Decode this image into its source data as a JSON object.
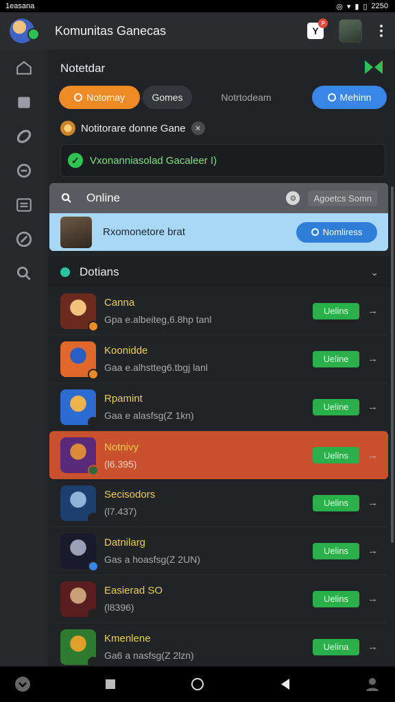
{
  "status_bar": {
    "left_text": "1easana",
    "time": "2250"
  },
  "app_bar": {
    "title": "Komunitas Ganecas",
    "notification_badge": "P"
  },
  "rail": {
    "icons": [
      "home-icon",
      "inbox-icon",
      "link-icon",
      "chat-icon",
      "list-icon",
      "close-icon",
      "search-icon"
    ]
  },
  "main": {
    "section_title": "Notetdar",
    "chips": [
      {
        "label": "Notomay",
        "active": true
      },
      {
        "label": "Gomes"
      },
      {
        "label": "Notrtodeam"
      },
      {
        "label": "Mehinn",
        "accent": "#3a86e6"
      }
    ],
    "notify_text": "Notitorare donne Gane",
    "banner_text": "Vxonanniasolad Gacaleer I)"
  },
  "online": {
    "header": "Online",
    "sort_label": "Agoetcs Somn",
    "user_name": "Rxomonetore brat",
    "user_button": "Nomliress"
  },
  "list": {
    "header": "Dotians",
    "rows": [
      {
        "name": "Canna",
        "sub": "Gpa e.albeiteg,6.8hp tanl",
        "status": "Uelins",
        "avatar": [
          "#6a2a1e",
          "#f2c27d"
        ],
        "mini": "#f08a24"
      },
      {
        "name": "Koonidde",
        "sub": "Gaa e.alhstteg6.tbgj lanl",
        "status": "Ueline",
        "avatar": [
          "#e0682a",
          "#2b5cc4"
        ],
        "mini": "#f08a24"
      },
      {
        "name": "Rpamint",
        "sub": "Gaa e alasfsg(Z 1kn)",
        "status": "Ueline",
        "avatar": [
          "#2c6bd1",
          "#f0b24a"
        ],
        "mini": "#222"
      },
      {
        "name": "Notnivy",
        "sub": "(l6.395)",
        "status": "Uelins",
        "avatar": [
          "#5a2a7a",
          "#d98b3a"
        ],
        "mini": "#2a6a3a",
        "highlight": true
      },
      {
        "name": "Secisodors",
        "sub": "(l7.437)",
        "status": "Uelins",
        "avatar": [
          "#1d3e6e",
          "#8fb3d9"
        ],
        "mini": "#222"
      },
      {
        "name": "Datnilarg",
        "sub": "Gas a hoasfsg(Z 2UN)",
        "status": "Uelins",
        "avatar": [
          "#1a1a2e",
          "#9aa0b5"
        ],
        "mini": "#3a86e6"
      },
      {
        "name": "Easierad SO",
        "sub": "(l8396)",
        "status": "Uelins",
        "avatar": [
          "#5a1e1e",
          "#c9a07a"
        ],
        "mini": "#222"
      },
      {
        "name": "Kmenlene",
        "sub": "Ga6 a nasfsg(Z 2lzn)",
        "status": "Uelina",
        "avatar": [
          "#2e7a2e",
          "#e0a02a"
        ],
        "mini": "#222"
      }
    ]
  },
  "nav_bar": {
    "icons": [
      "download-icon",
      "stop-icon",
      "home-circle-icon",
      "back-icon",
      "user-icon"
    ]
  }
}
